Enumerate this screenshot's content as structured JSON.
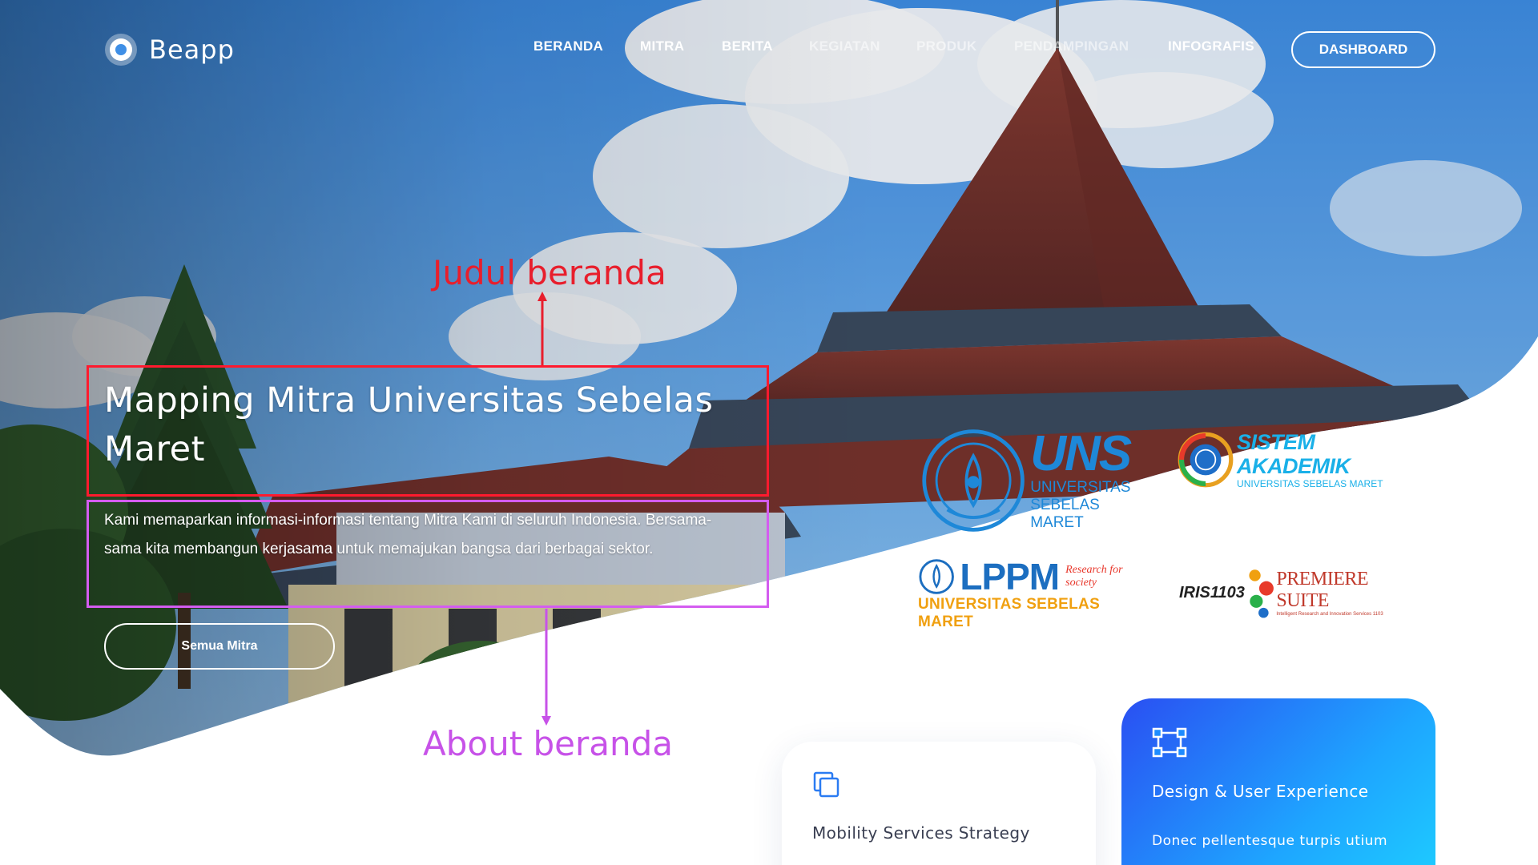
{
  "brand": {
    "name": "Beapp"
  },
  "nav": {
    "items": [
      {
        "label": "BERANDA"
      },
      {
        "label": "MITRA"
      },
      {
        "label": "BERITA"
      },
      {
        "label": "KEGIATAN"
      },
      {
        "label": "PRODUK"
      },
      {
        "label": "PENDAMPINGAN"
      },
      {
        "label": "INFOGRAFIS"
      }
    ],
    "dashboard_label": "DASHBOARD"
  },
  "hero": {
    "title": "Mapping Mitra Universitas Sebelas Maret",
    "about": "Kami memaparkan informasi-informasi tentang Mitra Kami di seluruh Indonesia. Bersama-sama kita membangun kerjasama untuk memajukan bangsa dari berbagai sektor.",
    "cta_label": "Semua Mitra"
  },
  "annotations": {
    "title_label": "Judul beranda",
    "about_label": "About beranda",
    "title_color": "#e81e2c",
    "about_color": "#c752e8"
  },
  "partners": {
    "uns": {
      "big": "UNS",
      "line1": "UNIVERSITAS",
      "line2": "SEBELAS MARET"
    },
    "siakad": {
      "big": "SISTEM AKADEMIK",
      "sub": "UNIVERSITAS SEBELAS MARET"
    },
    "lppm": {
      "big": "LPPM",
      "sub": "UNIVERSITAS SEBELAS MARET",
      "tag": "Research for society"
    },
    "iris": {
      "left": "IRIS1103",
      "right": "PREMIERE SUITE",
      "tag": "Intelligent Research and Innovation Services 1103"
    }
  },
  "services": [
    {
      "title": "Mobility Services Strategy",
      "icon": "copy-icon"
    },
    {
      "title": "Design & User Experience",
      "description": "Donec pellentesque turpis utium",
      "icon": "vector-frame-icon"
    }
  ],
  "colors": {
    "card_gradient_start": "#2a4ff2",
    "card_gradient_end": "#1ed1ff",
    "uns_blue": "#1e88d8",
    "lppm_orange": "#f0a010"
  }
}
